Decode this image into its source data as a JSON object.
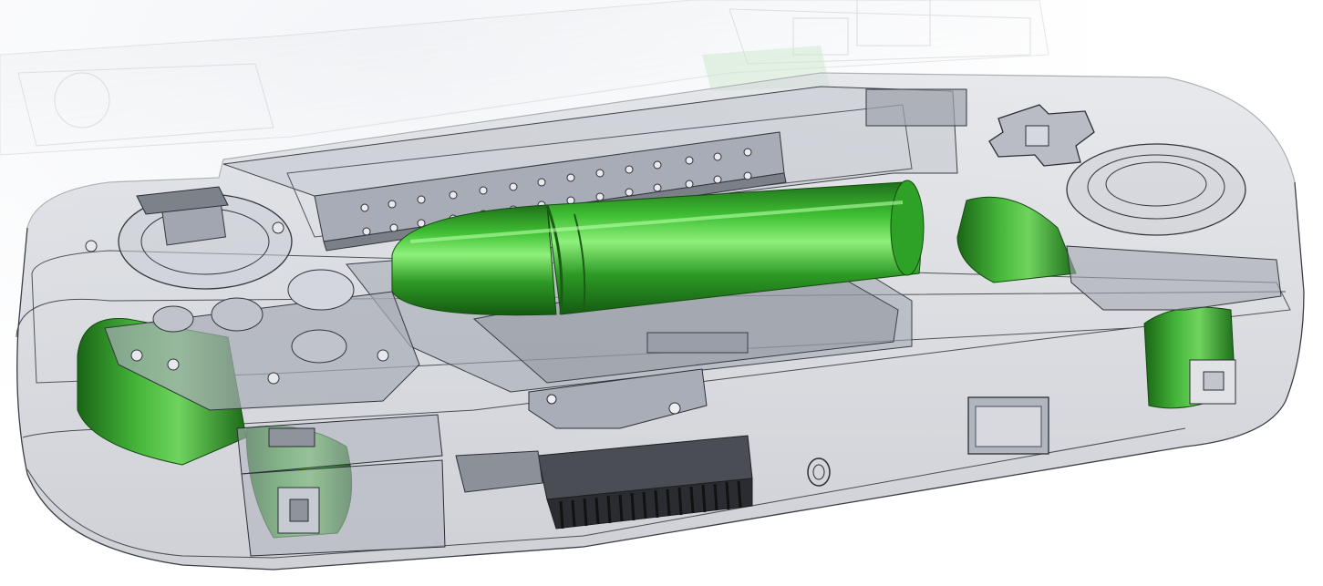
{
  "scene": {
    "subject": "cad-render",
    "colors": {
      "shell_fill": "#b8bcc6",
      "shell_stroke": "#3a3d45",
      "battery_green": "#2f9a2a",
      "battery_highlight": "#7de06c",
      "metal_plate": "#9fa3ad",
      "heatsink": "#2a2c31",
      "background": "#ffffff"
    }
  }
}
